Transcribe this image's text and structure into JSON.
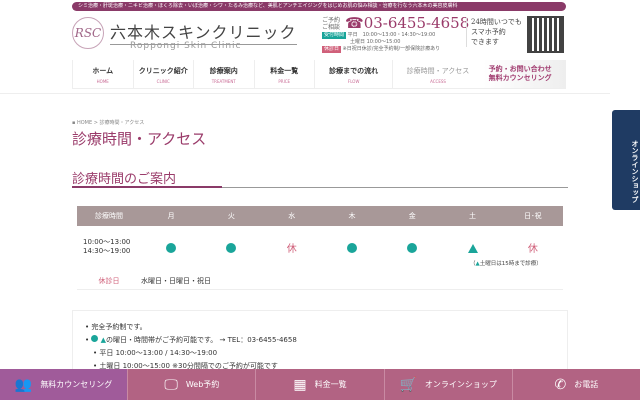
{
  "header": {
    "tagline": "シミ治療・肝斑治療・ニキビ治療・ほくろ除去・いぼ治療・シワ・たるみ治療など、美肌とアンチエイジングをはじめお肌の悩み相談・治療を行なう六本木の美容皮膚科",
    "logo_mark": "RSC",
    "logo_jp": "六本木スキンクリニック",
    "logo_en": "Roppongi Skin Clinic",
    "phone_label": "ご予約ご相談",
    "phone": "03-6455-4658",
    "hours_tag": "受付時間",
    "hours_weekday": "平日　10:00〜13:00・14:30〜19:00",
    "hours_sat": "土曜日 10:00〜15:00",
    "closed_tag": "休診日",
    "closed_info": "※日祝日休診/完全予約制/一部保険診療あり",
    "h24_line1": "24時間いつでも",
    "h24_line2": "スマホ予約",
    "h24_line3": "できます"
  },
  "nav": {
    "items": [
      {
        "jp": "ホーム",
        "en": "HOME"
      },
      {
        "jp": "クリニック紹介",
        "en": "CLINIC"
      },
      {
        "jp": "診療案内",
        "en": "TREATMENT"
      },
      {
        "jp": "料金一覧",
        "en": "PRICE"
      },
      {
        "jp": "診療までの流れ",
        "en": "FLOW"
      },
      {
        "jp": "診療時間・アクセス",
        "en": "ACCESS"
      }
    ],
    "cta_line1": "予約・お問い合わせ",
    "cta_line2": "無料カウンセリング"
  },
  "side_shop": {
    "label": "オンラインショップ"
  },
  "breadcrumb": "HOME > 診療時間・アクセス",
  "page_title": "診療時間・アクセス",
  "section_title": "診療時間のご案内",
  "schedule": {
    "headers": [
      "診療時間",
      "月",
      "火",
      "水",
      "木",
      "金",
      "土",
      "日･祝"
    ],
    "hours": [
      "10:00〜13:00",
      "14:30〜19:00"
    ],
    "days": [
      "open",
      "open",
      "休",
      "open",
      "open",
      "partial",
      "休"
    ],
    "note_mark": "▲",
    "note": "土曜日は15時まで診療）",
    "note_open": "（",
    "closed_label": "休診日",
    "closed_days": "水曜日・日曜日・祝日"
  },
  "info": {
    "line1": "完全予約制です。",
    "line2": "の曜日・時間帯がご予約可能です。 → TEL：03-6455-4658",
    "line3": "平日 10:00〜13:00 / 14:30〜19:00",
    "line4": "土曜日 10:00〜15:00 ※30分間隔でのご予約が可能です"
  },
  "bottom": [
    "無料カウンセリング",
    "Web予約",
    "料金一覧",
    "オンラインショップ",
    "お電話"
  ],
  "colors": {
    "brand": "#9a3b6a",
    "teal": "#1aa59a",
    "bar": "#b26383"
  }
}
